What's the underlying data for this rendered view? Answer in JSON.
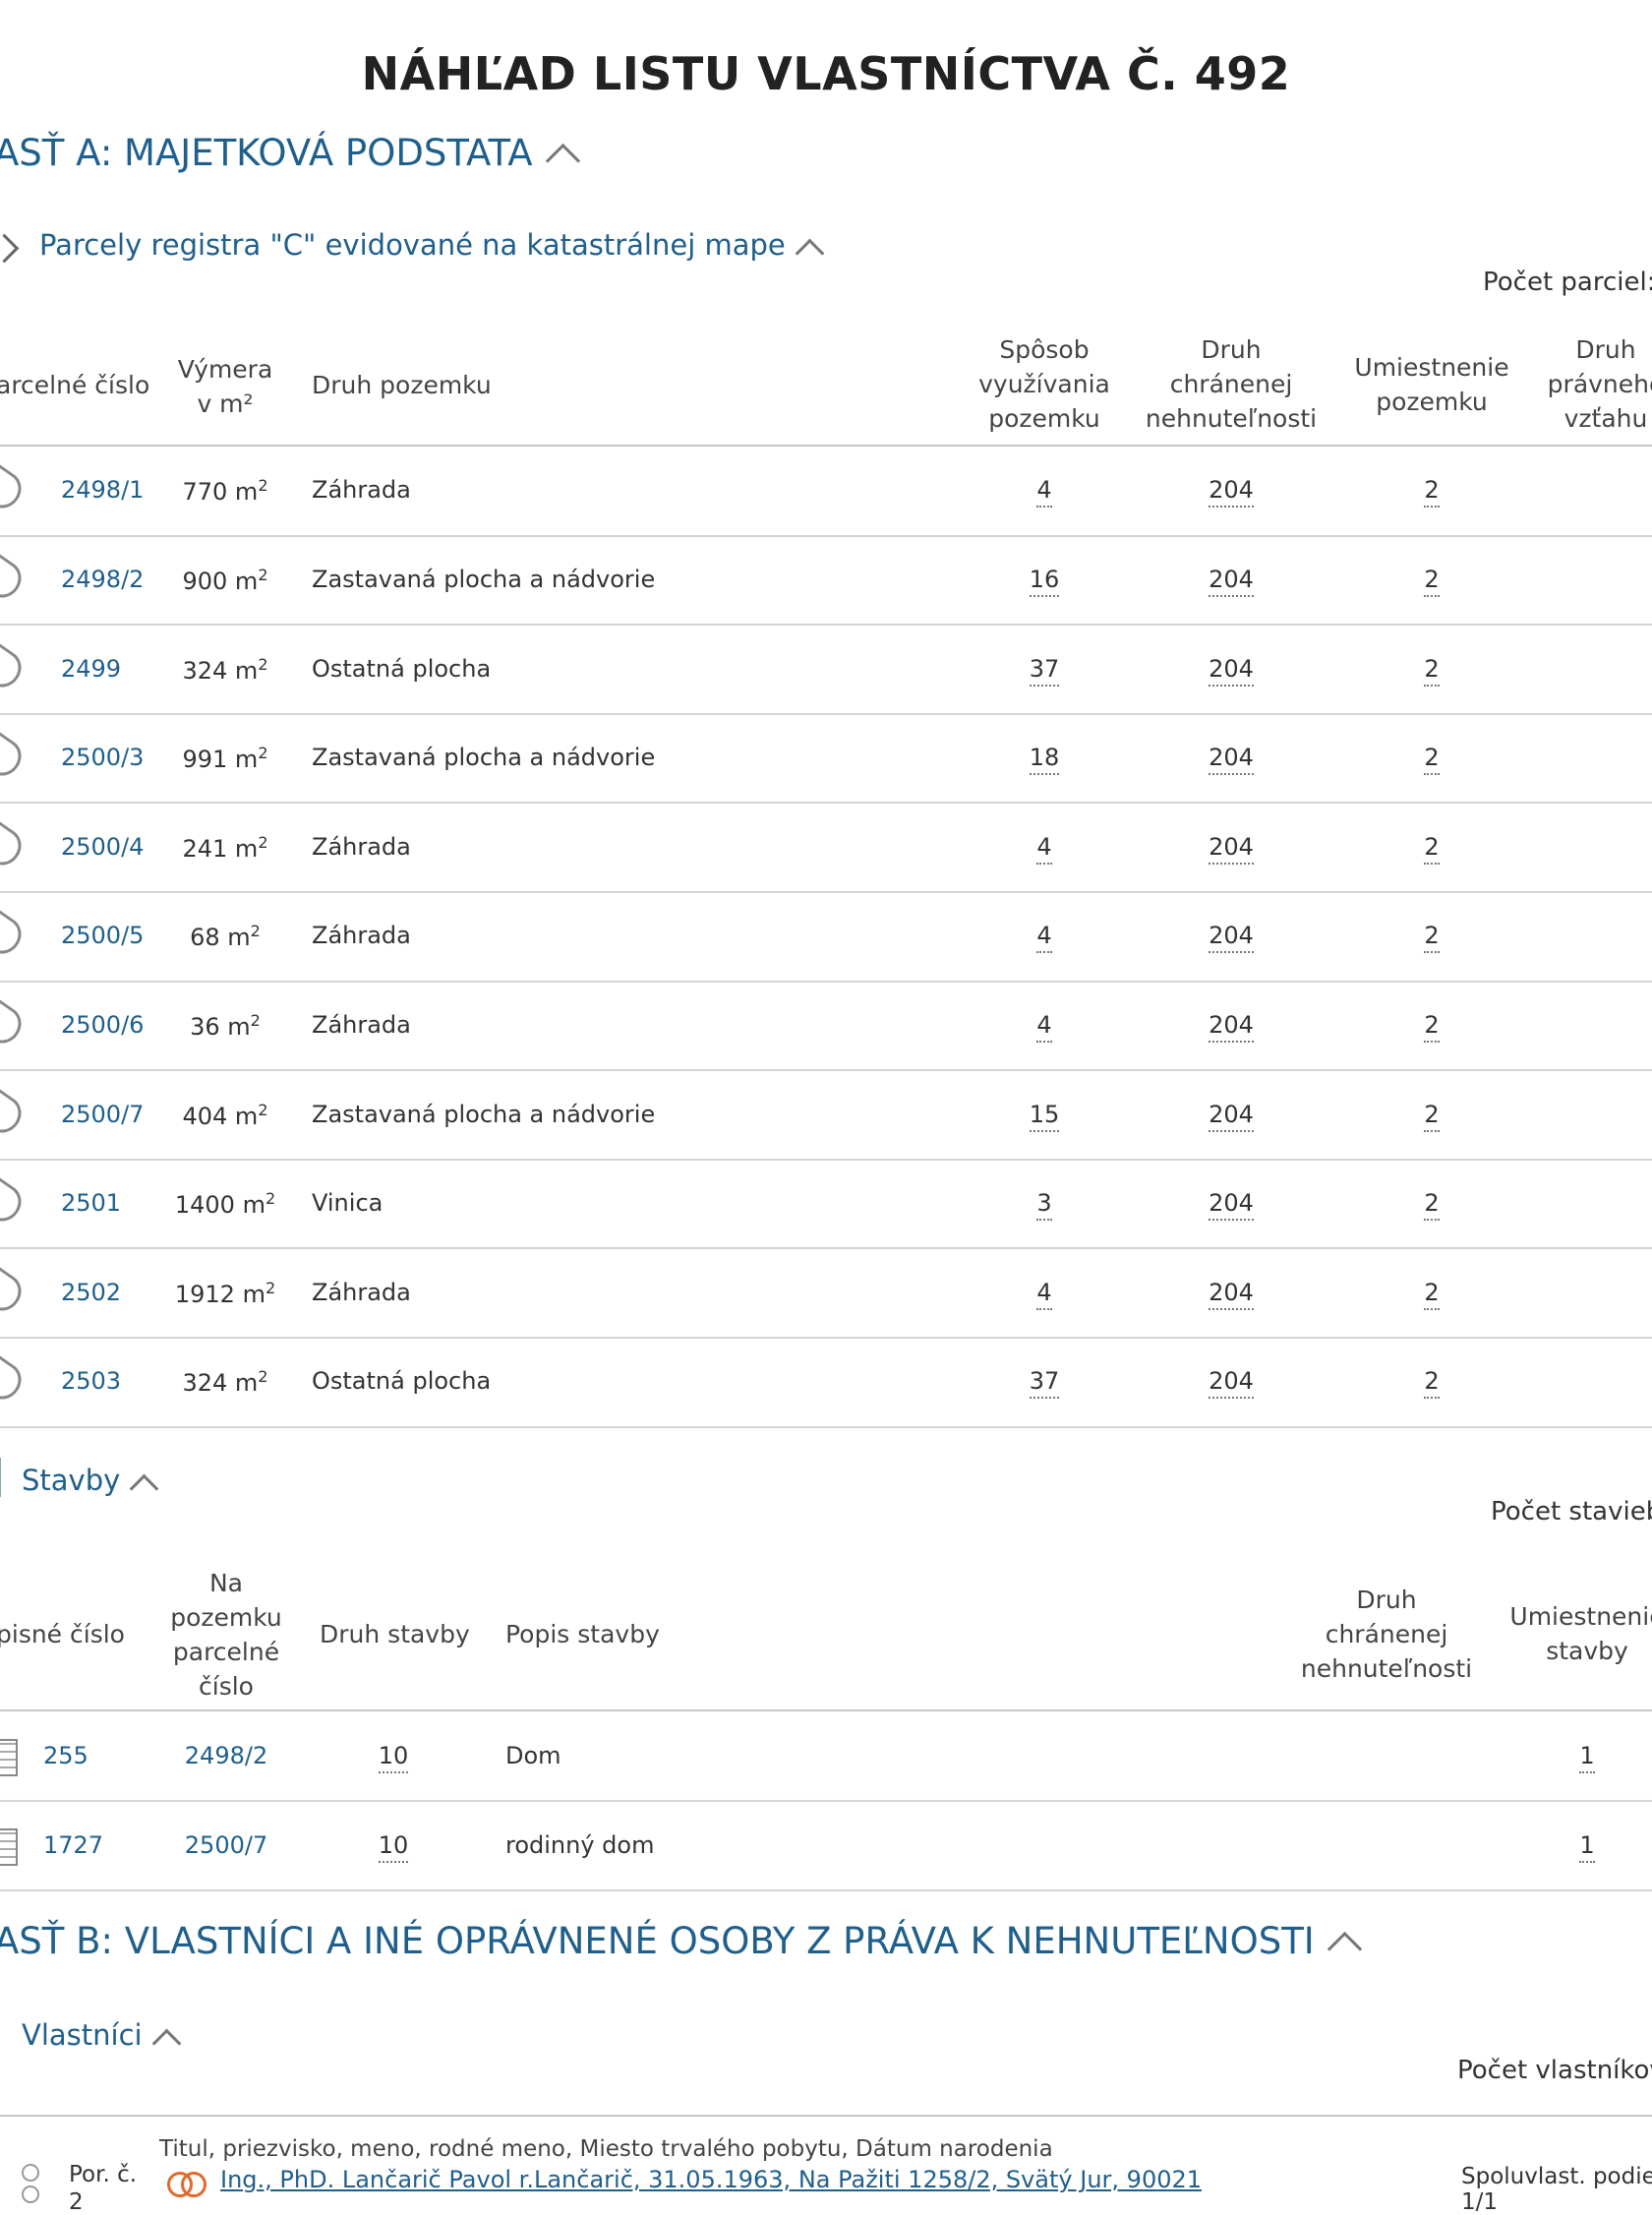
{
  "page_title": "NÁHĽAD LISTU VLASTNÍCTVA Č. 492",
  "section_a": {
    "title": "ASŤ A: MAJETKOVÁ PODSTATA",
    "parcels": {
      "title": "Parcely registra \"C\" evidované na katastrálnej mape",
      "count_label": "Počet parciel:",
      "headers": {
        "parcel_number": "arcelné číslo",
        "area_line1": "Výmera",
        "area_line2": "v m²",
        "land_type": "Druh pozemku",
        "usage_line1": "Spôsob",
        "usage_line2": "využívania",
        "usage_line3": "pozemku",
        "protected_line1": "Druh",
        "protected_line2": "chránenej",
        "protected_line3": "nehnuteľnosti",
        "location_line1": "Umiestnenie",
        "location_line2": "pozemku",
        "legal_line1": "Druh",
        "legal_line2": "právneho",
        "legal_line3": "vzťahu"
      },
      "rows": [
        {
          "number": "2498/1",
          "area": "770 m",
          "land_type": "Záhrada",
          "usage": "4",
          "protected": "204",
          "location": "2"
        },
        {
          "number": "2498/2",
          "area": "900 m",
          "land_type": "Zastavaná plocha a nádvorie",
          "usage": "16",
          "protected": "204",
          "location": "2"
        },
        {
          "number": "2499",
          "area": "324 m",
          "land_type": "Ostatná plocha",
          "usage": "37",
          "protected": "204",
          "location": "2"
        },
        {
          "number": "2500/3",
          "area": "991 m",
          "land_type": "Zastavaná plocha a nádvorie",
          "usage": "18",
          "protected": "204",
          "location": "2"
        },
        {
          "number": "2500/4",
          "area": "241 m",
          "land_type": "Záhrada",
          "usage": "4",
          "protected": "204",
          "location": "2"
        },
        {
          "number": "2500/5",
          "area": "68 m",
          "land_type": "Záhrada",
          "usage": "4",
          "protected": "204",
          "location": "2"
        },
        {
          "number": "2500/6",
          "area": "36 m",
          "land_type": "Záhrada",
          "usage": "4",
          "protected": "204",
          "location": "2"
        },
        {
          "number": "2500/7",
          "area": "404 m",
          "land_type": "Zastavaná plocha a nádvorie",
          "usage": "15",
          "protected": "204",
          "location": "2"
        },
        {
          "number": "2501",
          "area": "1400 m",
          "land_type": "Vinica",
          "usage": "3",
          "protected": "204",
          "location": "2"
        },
        {
          "number": "2502",
          "area": "1912 m",
          "land_type": "Záhrada",
          "usage": "4",
          "protected": "204",
          "location": "2"
        },
        {
          "number": "2503",
          "area": "324 m",
          "land_type": "Ostatná plocha",
          "usage": "37",
          "protected": "204",
          "location": "2"
        }
      ],
      "area_unit_sup": "2"
    },
    "buildings": {
      "title": "Stavby",
      "count_label": "Počet stavieb",
      "headers": {
        "supis": "pisné číslo",
        "on_parcel_line1": "Na",
        "on_parcel_line2": "pozemku",
        "on_parcel_line3": "parcelné",
        "on_parcel_line4": "číslo",
        "building_type": "Druh stavby",
        "description": "Popis stavby",
        "protected_line1": "Druh",
        "protected_line2": "chránenej",
        "protected_line3": "nehnuteľnosti",
        "location_line1": "Umiestnenie",
        "location_line2": "stavby"
      },
      "rows": [
        {
          "supis": "255",
          "parcel": "2498/2",
          "type": "10",
          "description": "Dom",
          "location": "1"
        },
        {
          "supis": "1727",
          "parcel": "2500/7",
          "type": "10",
          "description": "rodinný dom",
          "location": "1"
        }
      ]
    }
  },
  "section_b": {
    "title": "ASŤ B: VLASTNÍCI A INÉ OPRÁVNENÉ OSOBY Z PRÁVA K NEHNUTEĽNOSTI",
    "owners": {
      "title": "Vlastníci",
      "count_label": "Počet vlastníkov",
      "header_fields": "Titul, priezvisko, meno, rodné meno, Miesto trvalého pobytu, Dátum narodenia",
      "por_label": "Por. č.",
      "por_value": "2",
      "owner_text": "Ing., PhD. Lančarič Pavol r.Lančarič, 31.05.1963, Na Pažiti 1258/2, Svätý Jur, 90021",
      "share_label": "Spoluvlast. podie",
      "share_value": "1/1"
    }
  }
}
